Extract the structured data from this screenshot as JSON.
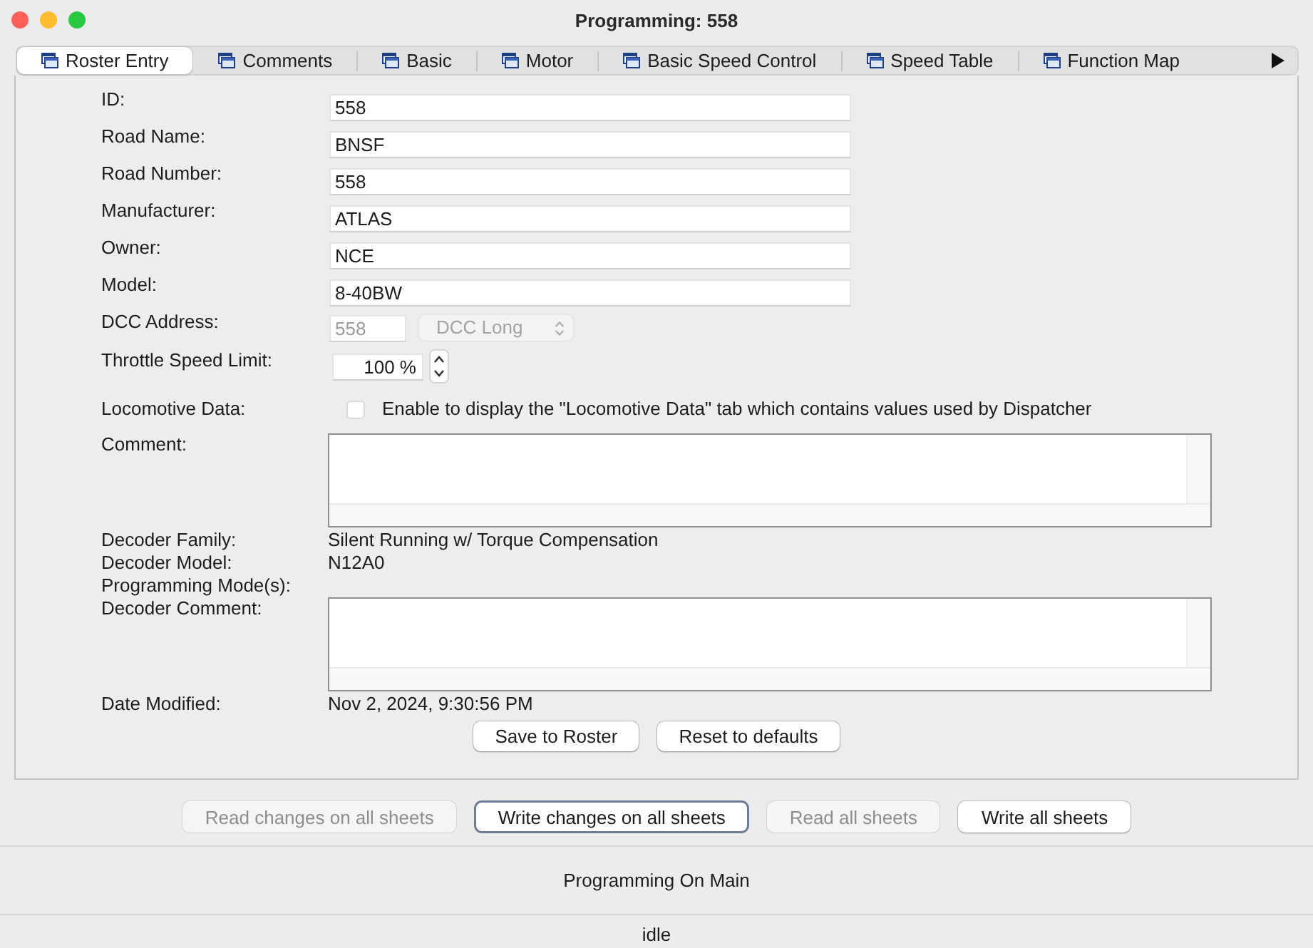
{
  "window": {
    "title": "Programming: 558"
  },
  "tabs": [
    {
      "label": "Roster Entry",
      "selected": true
    },
    {
      "label": "Comments",
      "selected": false
    },
    {
      "label": "Basic",
      "selected": false
    },
    {
      "label": "Motor",
      "selected": false
    },
    {
      "label": "Basic Speed Control",
      "selected": false
    },
    {
      "label": "Speed Table",
      "selected": false
    },
    {
      "label": "Function Map",
      "selected": false
    }
  ],
  "form": {
    "fields": [
      {
        "kind": "text",
        "label": "ID:",
        "value": "558"
      },
      {
        "kind": "text",
        "label": "Road Name:",
        "value": "BNSF"
      },
      {
        "kind": "text",
        "label": "Road Number:",
        "value": "558"
      },
      {
        "kind": "text",
        "label": "Manufacturer:",
        "value": "ATLAS"
      },
      {
        "kind": "text",
        "label": "Owner:",
        "value": "NCE"
      },
      {
        "kind": "text",
        "label": "Model:",
        "value": "8-40BW"
      },
      {
        "kind": "address",
        "label": "DCC Address:",
        "value": "558",
        "mode": "DCC Long",
        "disabled": true
      },
      {
        "kind": "spinner",
        "label": "Throttle Speed Limit:",
        "value": "100 %"
      },
      {
        "kind": "checkbox",
        "label": "Locomotive Data:",
        "checked": false,
        "text": "Enable to display the \"Locomotive Data\" tab which contains values used by Dispatcher"
      },
      {
        "kind": "textarea",
        "label": "Comment:"
      },
      {
        "kind": "info",
        "label": "Decoder Family:",
        "value": "Silent Running w/ Torque Compensation"
      },
      {
        "kind": "info",
        "label": "Decoder Model:",
        "value": "N12A0"
      },
      {
        "kind": "info",
        "label": "Programming Mode(s):"
      },
      {
        "kind": "textarea",
        "label": "Decoder Comment:"
      },
      {
        "kind": "info",
        "label": "Date Modified:",
        "value": "Nov 2, 2024, 9:30:56 PM"
      }
    ],
    "buttons": [
      "Save to Roster",
      "Reset to defaults"
    ]
  },
  "sheet_buttons": [
    {
      "label": "Read changes on all sheets",
      "disabled": true,
      "focused": false
    },
    {
      "label": "Write changes on all sheets",
      "disabled": false,
      "focused": true
    },
    {
      "label": "Read all sheets",
      "disabled": true,
      "focused": false
    },
    {
      "label": "Write all sheets",
      "disabled": false,
      "focused": false
    }
  ],
  "mode": "Programming On Main",
  "status_bar": "idle"
}
